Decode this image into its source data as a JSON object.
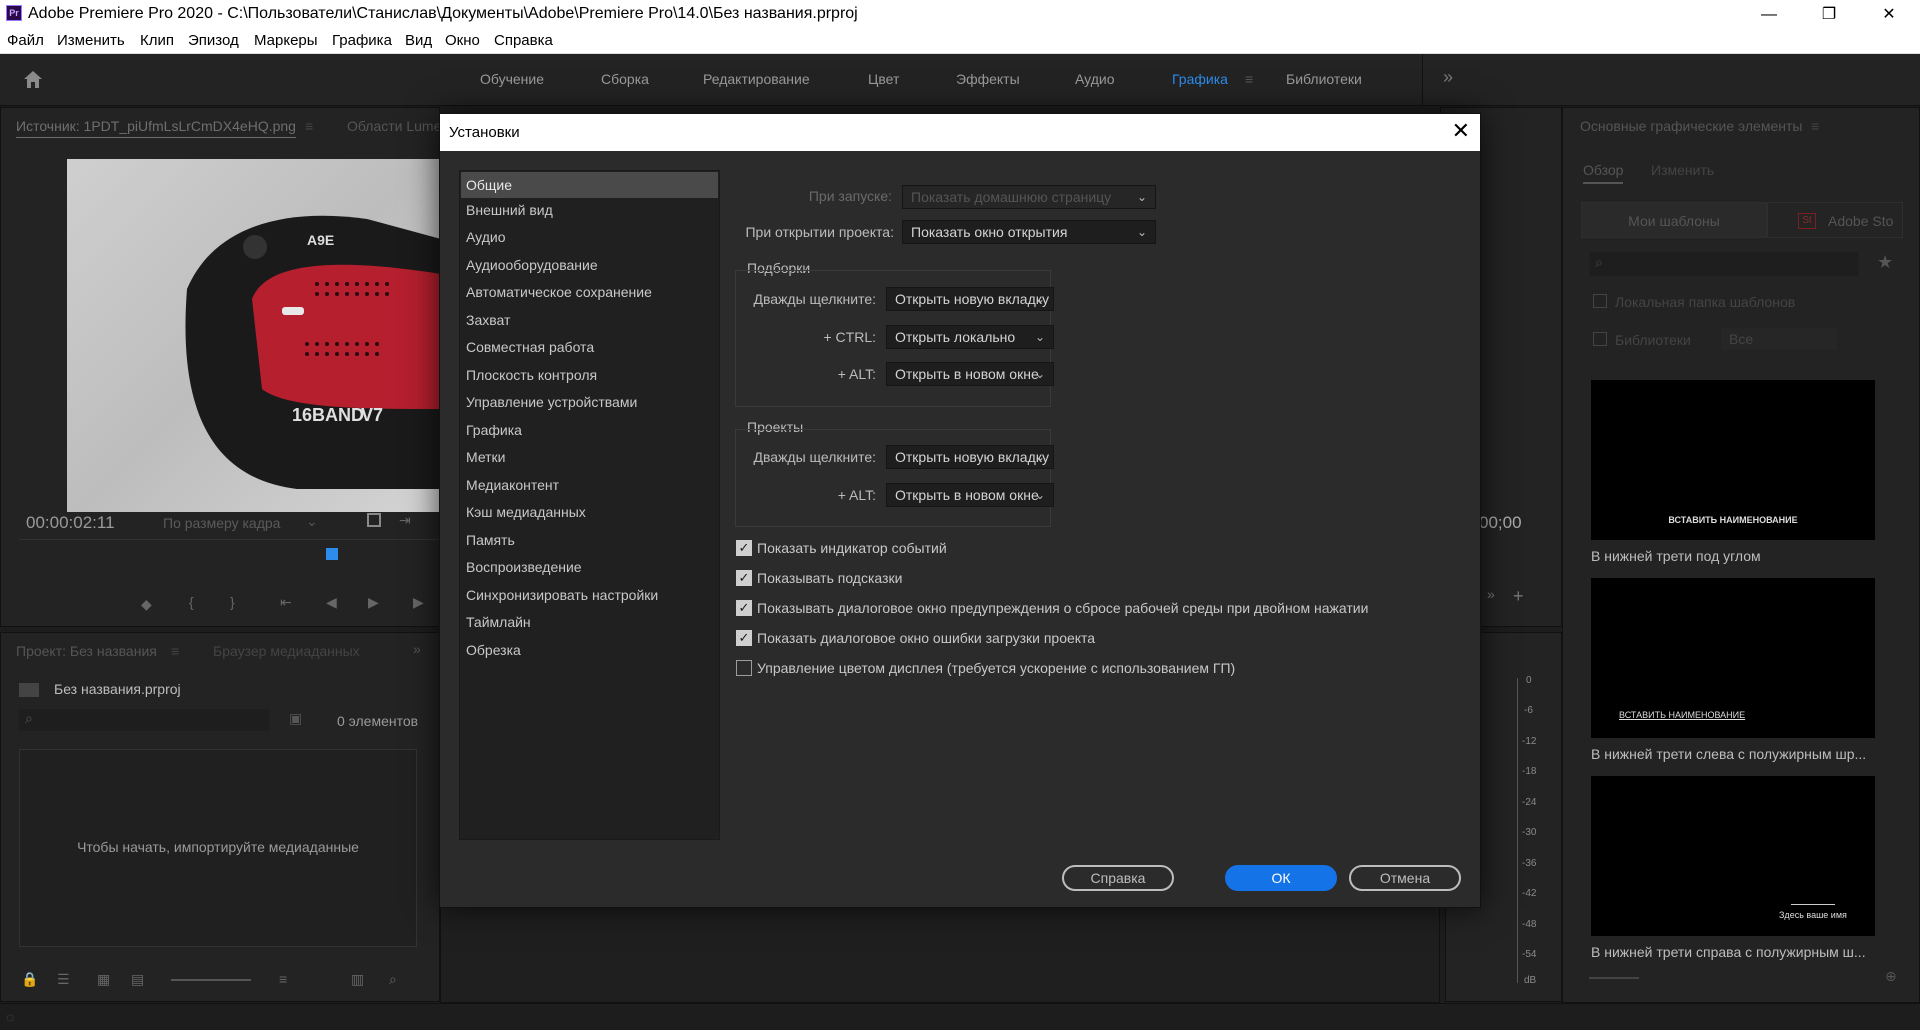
{
  "titlebar": {
    "icon": "Pr",
    "title": "Adobe Premiere Pro 2020 - C:\\Пользователи\\Станислав\\Документы\\Adobe\\Premiere Pro\\14.0\\Без названия.prproj",
    "minimize": "—",
    "maximize": "❐",
    "close": "✕"
  },
  "menu": [
    "Файл",
    "Изменить",
    "Клип",
    "Эпизод",
    "Маркеры",
    "Графика",
    "Вид",
    "Окно",
    "Справка"
  ],
  "workspaces": {
    "tabs": [
      "Обучение",
      "Сборка",
      "Редактирование",
      "Цвет",
      "Эффекты",
      "Аудио",
      "Графика",
      "Библиотеки"
    ],
    "active": "Графика",
    "more": "»"
  },
  "source_panel": {
    "tab": "Источник: 1PDT_piUfmLsLrCmDX4eHQ.png",
    "tab2": "Области Lume",
    "timecode": "00:00:02:11",
    "fit": "По размеру кадра",
    "photo_text_left": "16BAND",
    "photo_text_right": "V7",
    "brand_plate": "A9E"
  },
  "program_panel": {
    "timecode_tail": "00;00"
  },
  "project_panel": {
    "tab": "Проект: Без названия",
    "tab2": "Браузер медиаданных",
    "file": "Без названия.prproj",
    "count": "0 элементов",
    "empty_message": "Чтобы начать, импортируйте медиаданные"
  },
  "essential_graphics": {
    "title": "Основные графические элементы",
    "tabs": [
      "Обзор",
      "Изменить"
    ],
    "sources": [
      "Мои шаблоны",
      "Adobe Sto"
    ],
    "adobe_stock_badge": "St",
    "checks": [
      "Локальная папка шаблонов",
      "Библиотеки"
    ],
    "libraries_select": "Все",
    "templates": [
      {
        "caption": "В нижней трети под углом",
        "inner": "ВСТАВИТЬ НАИМЕНОВАНИЕ"
      },
      {
        "caption": "В нижней трети слева с полужирным шр...",
        "inner": "ВСТАВИТЬ НАИМЕНОВАНИЕ"
      },
      {
        "caption": "В нижней трети справа с полужирным ш...",
        "inner": "Здесь ваше имя"
      }
    ]
  },
  "meter": {
    "labels": [
      "0",
      "-6",
      "-12",
      "-18",
      "-24",
      "-30",
      "-36",
      "-42",
      "-48",
      "-54",
      "dB"
    ]
  },
  "dialog": {
    "title": "Установки",
    "close": "✕",
    "categories": [
      "Общие",
      "Внешний вид",
      "Аудио",
      "Аудиооборудование",
      "Автоматическое сохранение",
      "Захват",
      "Совместная работа",
      "Плоскость контроля",
      "Управление устройствами",
      "Графика",
      "Метки",
      "Медиаконтент",
      "Кэш медиаданных",
      "Память",
      "Воспроизведение",
      "Синхронизировать настройки",
      "Таймлайн",
      "Обрезка"
    ],
    "selected_category": "Общие",
    "startup": {
      "label": "При запуске:",
      "value": "Показать домашнюю страницу"
    },
    "open_project": {
      "label": "При открытии проекта:",
      "value": "Показать окно открытия"
    },
    "bins": {
      "title": "Подборки",
      "rows": [
        {
          "label": "Дважды щелкните:",
          "value": "Открыть новую вкладку"
        },
        {
          "label": "+ CTRL:",
          "value": "Открыть локально"
        },
        {
          "label": "+ ALT:",
          "value": "Открыть в новом окне"
        }
      ]
    },
    "projects": {
      "title": "Проекты",
      "rows": [
        {
          "label": "Дважды щелкните:",
          "value": "Открыть новую вкладку"
        },
        {
          "label": "+ ALT:",
          "value": "Открыть в новом окне"
        }
      ]
    },
    "checkboxes": [
      {
        "label": "Показать индикатор событий",
        "checked": true
      },
      {
        "label": "Показывать подсказки",
        "checked": true
      },
      {
        "label": "Показывать диалоговое окно предупреждения о сбросе рабочей среды при двойном нажатии",
        "checked": true
      },
      {
        "label": "Показать диалоговое окно ошибки загрузки проекта",
        "checked": true
      },
      {
        "label": "Управление цветом дисплея (требуется ускорение с использованием ГП)",
        "checked": false
      }
    ],
    "buttons": {
      "help": "Справка",
      "ok": "ОК",
      "cancel": "Отмена"
    }
  },
  "colors": {
    "accent": "#1473e6",
    "workspace_active": "#2d8ceb",
    "panel_bg": "#232323",
    "dialog_bg": "#2b2b2b"
  }
}
